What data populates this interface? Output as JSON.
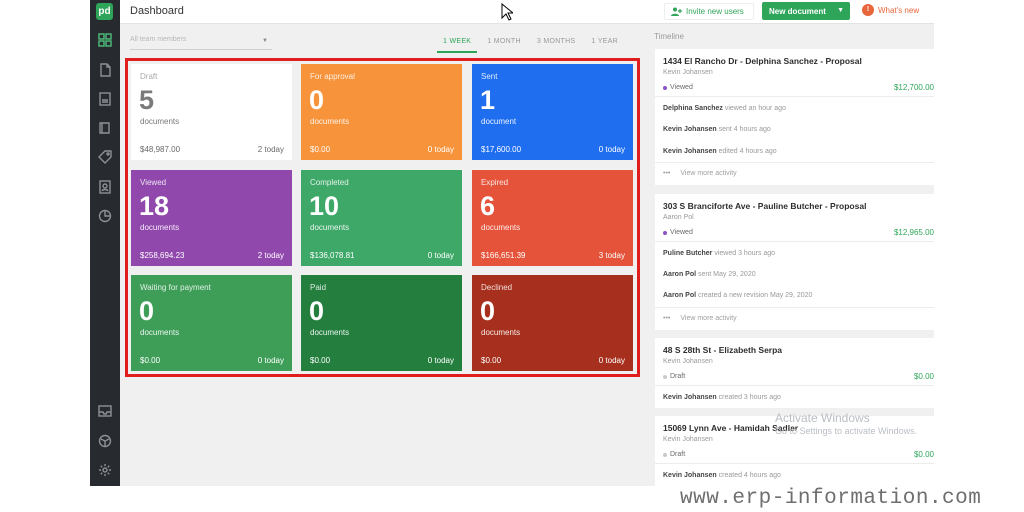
{
  "app": {
    "logo": "pd",
    "title": "Dashboard"
  },
  "header": {
    "invite_label": "Invite new users",
    "new_document_label": "New document",
    "whats_new_label": "What's new",
    "whats_new_badge": "!"
  },
  "filters": {
    "team_placeholder": "All team members",
    "periods": [
      "1 WEEK",
      "1 MONTH",
      "3 MONTHS",
      "1 YEAR"
    ],
    "active_period": "1 WEEK"
  },
  "tiles": [
    {
      "label": "Draft",
      "count": "5",
      "unit": "documents",
      "amount": "$48,987.00",
      "today": "2 today",
      "color": "#ffffff"
    },
    {
      "label": "For approval",
      "count": "0",
      "unit": "documents",
      "amount": "$0.00",
      "today": "0 today",
      "color": "#f7933b"
    },
    {
      "label": "Sent",
      "count": "1",
      "unit": "document",
      "amount": "$17,600.00",
      "today": "0 today",
      "color": "#1f6ef0"
    },
    {
      "label": "Viewed",
      "count": "18",
      "unit": "documents",
      "amount": "$258,694.23",
      "today": "2 today",
      "color": "#9148ad"
    },
    {
      "label": "Completed",
      "count": "10",
      "unit": "documents",
      "amount": "$136,078.81",
      "today": "0 today",
      "color": "#3ea868"
    },
    {
      "label": "Expired",
      "count": "6",
      "unit": "documents",
      "amount": "$166,651.39",
      "today": "3 today",
      "color": "#e4533a"
    },
    {
      "label": "Waiting for payment",
      "count": "0",
      "unit": "documents",
      "amount": "$0.00",
      "today": "0 today",
      "color": "#3e9e58"
    },
    {
      "label": "Paid",
      "count": "0",
      "unit": "documents",
      "amount": "$0.00",
      "today": "0 today",
      "color": "#247f3f"
    },
    {
      "label": "Declined",
      "count": "0",
      "unit": "documents",
      "amount": "$0.00",
      "today": "0 today",
      "color": "#a6301d"
    }
  ],
  "timeline": {
    "title": "Timeline",
    "view_more": "View more activity",
    "cards": [
      {
        "title": "1434 El Rancho Dr - Delphina Sanchez - Proposal",
        "author": "Kevin Johansen",
        "status": "Viewed",
        "price": "$12,700.00",
        "activities": [
          {
            "who": "Delphina Sanchez",
            "what": " viewed an hour ago"
          },
          {
            "who": "Kevin Johansen",
            "what": " sent 4 hours ago"
          },
          {
            "who": "Kevin Johansen",
            "what": " edited 4 hours ago"
          }
        ]
      },
      {
        "title": "303 S Branciforte Ave - Pauline Butcher - Proposal",
        "author": "Aaron Pol",
        "status": "Viewed",
        "price": "$12,965.00",
        "activities": [
          {
            "who": "Puline Butcher",
            "what": " viewed 3 hours ago"
          },
          {
            "who": "Aaron Pol",
            "what": " sent May 29, 2020"
          },
          {
            "who": "Aaron Pol",
            "what": " created a new revision May 29, 2020"
          }
        ]
      },
      {
        "title": "48 S 28th St - Elizabeth Serpa",
        "author": "Kevin Johansen",
        "status": "Draft",
        "price": "$0.00",
        "activities": [
          {
            "who": "Kevin Johansen",
            "what": " created 3 hours ago"
          }
        ]
      },
      {
        "title": "15069 Lynn Ave - Hamidah Sadler",
        "author": "Kevin Johansen",
        "status": "Draft",
        "price": "$0.00",
        "activities": [
          {
            "who": "Kevin Johansen",
            "what": " created 4 hours ago"
          }
        ]
      }
    ]
  },
  "windows_watermark": {
    "line1": "Activate Windows",
    "line2": "Go to Settings to activate Windows."
  },
  "site_watermark": "www.erp-information.com"
}
